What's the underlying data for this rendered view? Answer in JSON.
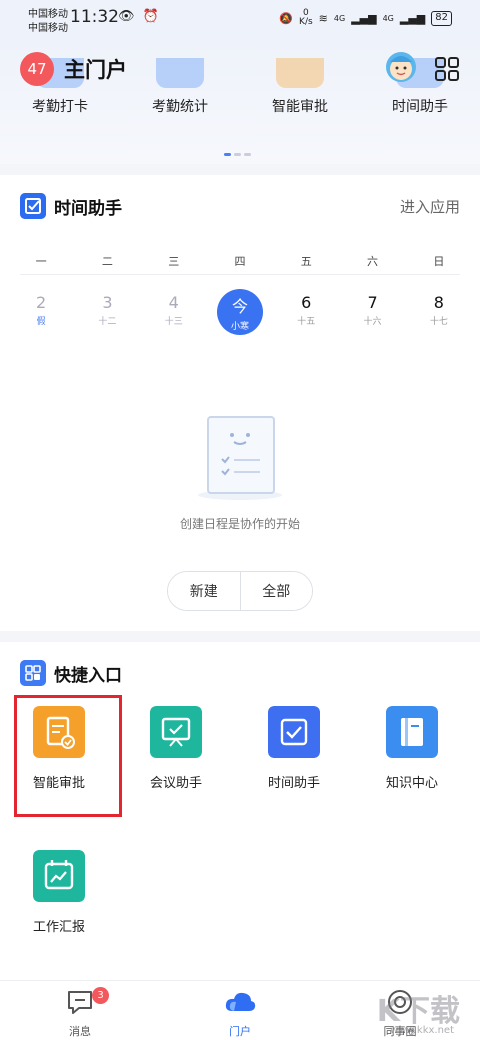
{
  "status_bar": {
    "carrier1": "中国移动",
    "carrier2": "中国移动",
    "time": "11:32",
    "net_speed_value": "0",
    "net_speed_unit": "K/s",
    "signal1": "4G",
    "signal2": "4G",
    "battery": "82"
  },
  "header": {
    "badge_count": "47",
    "title": "主门户",
    "apps": [
      {
        "label": "考勤打卡",
        "color": "#4a8cf5"
      },
      {
        "label": "考勤统计",
        "color": "#4a8cf5"
      },
      {
        "label": "智能审批",
        "color": "#f5a02a"
      },
      {
        "label": "时间助手",
        "color": "#4a8cf5"
      }
    ]
  },
  "time_helper": {
    "title": "时间助手",
    "enter_app": "进入应用",
    "weekdays": [
      "一",
      "二",
      "三",
      "四",
      "五",
      "六",
      "日"
    ],
    "dates": [
      {
        "num": "2",
        "sub": "假"
      },
      {
        "num": "3",
        "sub": "十二"
      },
      {
        "num": "4",
        "sub": "十三"
      },
      {
        "num": "今",
        "sub": "小寒"
      },
      {
        "num": "6",
        "sub": "十五"
      },
      {
        "num": "7",
        "sub": "十六"
      },
      {
        "num": "8",
        "sub": "十七"
      }
    ],
    "empty_text": "创建日程是协作的开始",
    "new_button": "新建",
    "all_button": "全部"
  },
  "quick_entry": {
    "title": "快捷入口",
    "items": [
      {
        "label": "智能审批",
        "color": "#f5a02a"
      },
      {
        "label": "会议助手",
        "color": "#1fb69e"
      },
      {
        "label": "时间助手",
        "color": "#3d6ff0"
      },
      {
        "label": "知识中心",
        "color": "#3c8df0"
      },
      {
        "label": "工作汇报",
        "color": "#1fb69e"
      }
    ]
  },
  "bottom_nav": {
    "messages": "消息",
    "messages_badge": "3",
    "portal": "门户",
    "colleagues": "同事圈",
    "watermark": "K下载",
    "watermark_url": "www.kkx.net"
  },
  "colors": {
    "accent": "#3a73f2",
    "badge_red": "#f2585c",
    "highlight": "#e2262f"
  }
}
